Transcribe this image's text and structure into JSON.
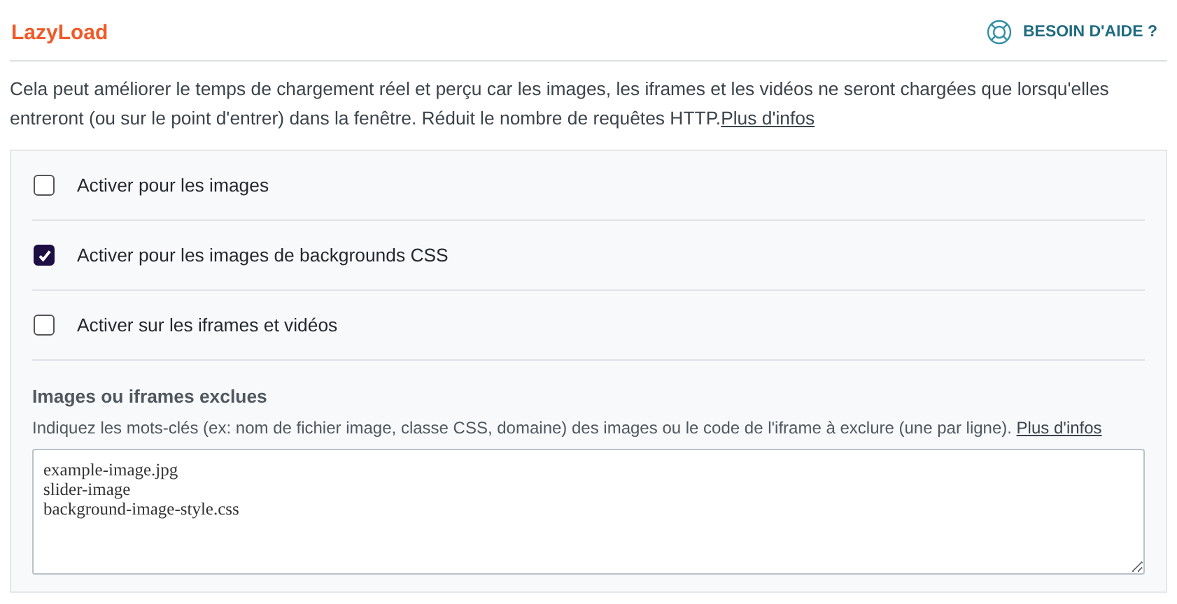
{
  "header": {
    "title": "LazyLoad",
    "help_link": "BESOIN D'AIDE ?"
  },
  "description": {
    "text": "Cela peut améliorer le temps de chargement réel et perçu car les images, les iframes et les vidéos ne seront chargées que lorsqu'elles entreront (ou sur le point d'entrer) dans la fenêtre. Réduit le nombre de requêtes HTTP.",
    "link": "Plus d'infos"
  },
  "options": [
    {
      "label": "Activer pour les images",
      "checked": false
    },
    {
      "label": "Activer pour les images de backgrounds CSS",
      "checked": true
    },
    {
      "label": "Activer sur les iframes et vidéos",
      "checked": false
    }
  ],
  "exclusions": {
    "title": "Images ou iframes exclues",
    "hint": "Indiquez les mots-clés (ex: nom de fichier image, classe CSS, domaine) des images ou le code de l'iframe à exclure (une par ligne).",
    "link": "Plus d'infos",
    "value": "example-image.jpg\nslider-image\nbackground-image-style.css"
  }
}
